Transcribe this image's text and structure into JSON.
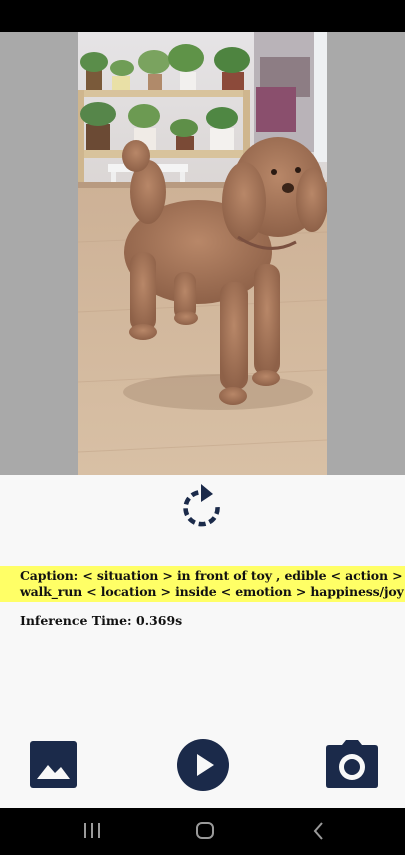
{
  "photo": {
    "subject": "brown curly poodle on wooden floor"
  },
  "refresh": {
    "icon": "refresh-icon"
  },
  "caption": {
    "line1": "Caption: < situation > in front of toy , edible < action >",
    "line2": "walk_run < location > inside < emotion > happiness/joy"
  },
  "inference": {
    "text": "Inference Time: 0.369s"
  },
  "bottom_bar": {
    "gallery_icon": "gallery-icon",
    "play_icon": "play-icon",
    "camera_icon": "camera-icon"
  },
  "nav": {
    "recent_icon": "recent-apps-icon",
    "home_icon": "home-icon",
    "back_icon": "back-icon"
  },
  "colors": {
    "accent": "#1b2a4a",
    "caption_bg": "#ffff66",
    "image_bg": "#a9a9a9",
    "app_bg": "#f8f8f8"
  }
}
